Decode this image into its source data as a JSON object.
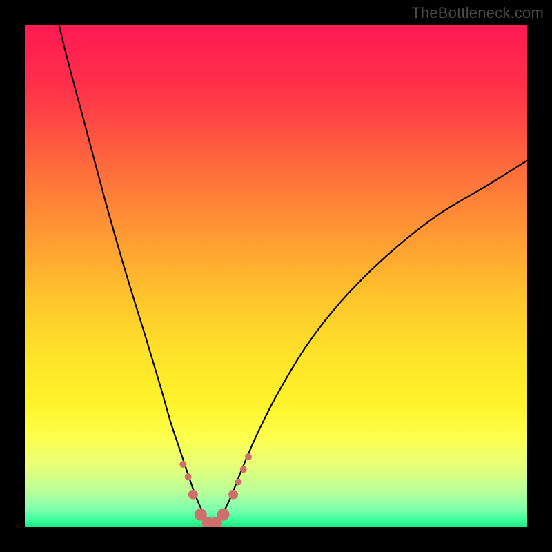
{
  "watermark": "TheBottleneck.com",
  "colors": {
    "frame_bg": "#000000",
    "curve": "#000000",
    "marker_fill": "#cf6f6b",
    "marker_stroke": "#b85b57",
    "gradient_stops": [
      {
        "offset": 0.0,
        "color": "#ff1a52"
      },
      {
        "offset": 0.12,
        "color": "#ff2f4a"
      },
      {
        "offset": 0.28,
        "color": "#ff6a3c"
      },
      {
        "offset": 0.42,
        "color": "#ff9a33"
      },
      {
        "offset": 0.55,
        "color": "#ffc72c"
      },
      {
        "offset": 0.66,
        "color": "#ffe32a"
      },
      {
        "offset": 0.75,
        "color": "#fff32a"
      },
      {
        "offset": 0.82,
        "color": "#fdff4c"
      },
      {
        "offset": 0.88,
        "color": "#e6ff7a"
      },
      {
        "offset": 0.93,
        "color": "#b8ff9a"
      },
      {
        "offset": 0.965,
        "color": "#7dffad"
      },
      {
        "offset": 0.985,
        "color": "#3fff9d"
      },
      {
        "offset": 1.0,
        "color": "#17e87c"
      }
    ]
  },
  "chart_data": {
    "type": "line",
    "title": "",
    "xlabel": "",
    "ylabel": "",
    "xlim": [
      0,
      100
    ],
    "ylim": [
      0,
      100
    ],
    "series": [
      {
        "name": "curve-left",
        "x": [
          5,
          8,
          12,
          16,
          20,
          24,
          27,
          29,
          31,
          33,
          34.5,
          36,
          37.5
        ],
        "values": [
          108,
          95,
          80,
          65,
          51,
          38,
          28,
          21,
          15,
          9,
          5,
          2,
          0.5
        ]
      },
      {
        "name": "curve-right",
        "x": [
          37.5,
          39,
          41,
          43,
          46,
          50,
          56,
          63,
          72,
          82,
          92,
          100
        ],
        "values": [
          0.5,
          2,
          6,
          11,
          18,
          26,
          36,
          45,
          54,
          62,
          68,
          73
        ]
      }
    ],
    "markers": {
      "name": "highlight-dots",
      "x": [
        31.5,
        32.5,
        33.5,
        35.0,
        36.5,
        38.0,
        39.5,
        41.5,
        42.5,
        43.5,
        44.5
      ],
      "values": [
        12.5,
        10.0,
        6.5,
        2.5,
        0.8,
        0.8,
        2.5,
        6.5,
        9.0,
        11.5,
        14.0
      ],
      "radius": [
        5,
        5,
        7,
        9,
        9,
        9,
        9,
        7,
        5,
        5,
        5
      ]
    }
  }
}
